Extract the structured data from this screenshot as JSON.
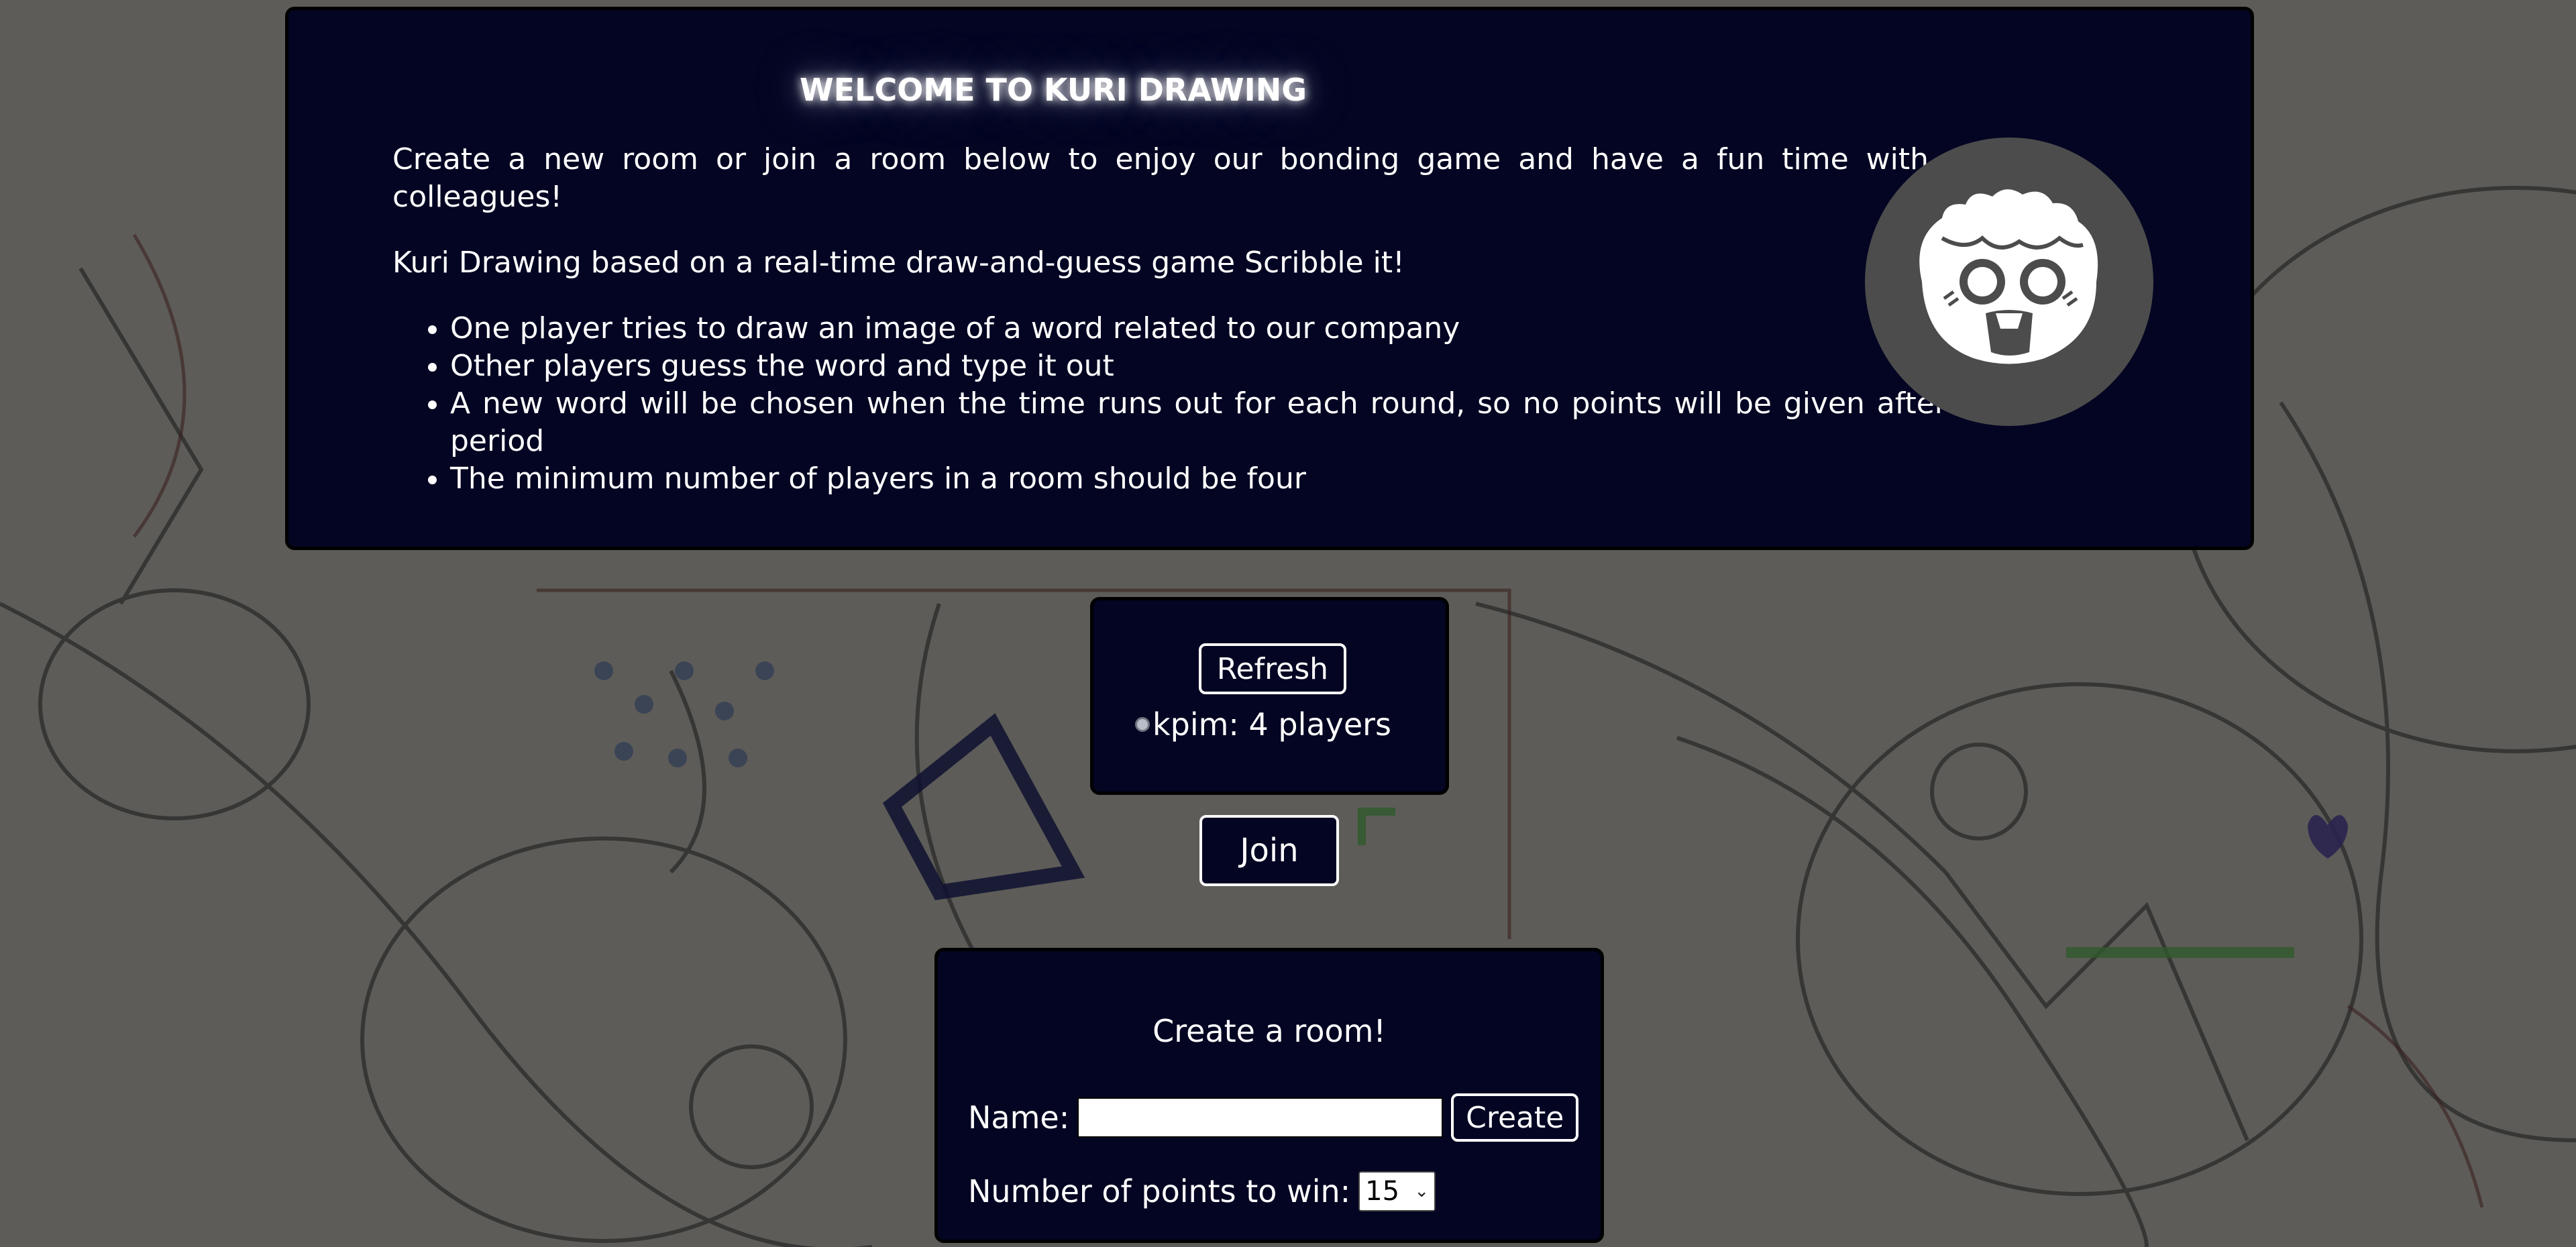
{
  "intro": {
    "title": "WELCOME TO KURI DRAWING",
    "paragraph1": "Create a new room or join a room below to enjoy our bonding game and have a fun time with your colleagues!",
    "paragraph2": "Kuri Drawing based on a real-time draw-and-guess game Scribble it!",
    "rules": [
      "One player tries to draw an image of a word related to our company",
      "Other players guess the word and type it out",
      "A new word will be chosen when the time runs out for each round, so no points will be given after this period",
      "The minimum number of players in a room should be four"
    ],
    "avatar_icon": "kuri-face-icon"
  },
  "rooms": {
    "refresh_label": "Refresh",
    "items": [
      {
        "label": "kpim: 4 players",
        "selected": false
      }
    ]
  },
  "join_label": "Join",
  "create": {
    "title": "Create a room!",
    "name_label": "Name:",
    "name_value": "",
    "create_label": "Create",
    "points_label": "Number of points to win:",
    "points_value": "15"
  },
  "colors": {
    "panel": "#030522",
    "avatar_bg": "#4c4c4c",
    "text": "#ffffff"
  }
}
